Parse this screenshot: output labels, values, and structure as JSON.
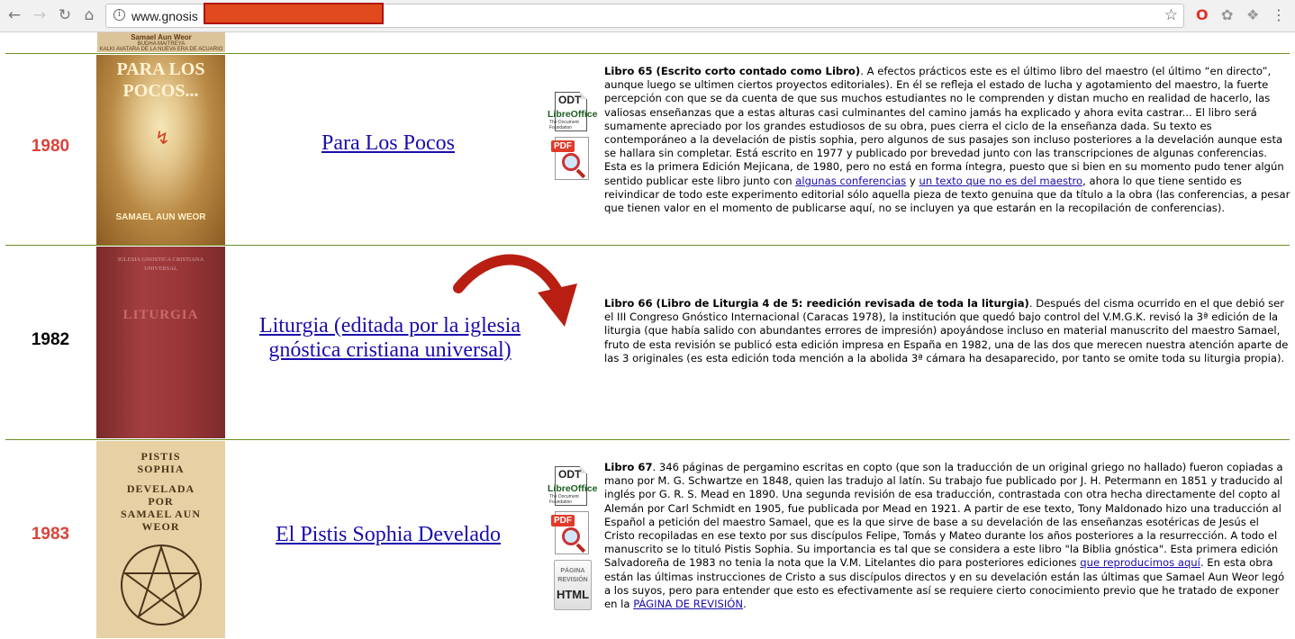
{
  "browser": {
    "url": "www.gnosis",
    "icons": {
      "back": "back-arrow-icon",
      "forward": "forward-arrow-icon",
      "reload": "reload-icon",
      "home": "home-icon",
      "info": "info-icon",
      "bookmark": "star-icon"
    }
  },
  "top_cover_text": [
    "Samael Aun Weor",
    "BUDHA MAITREYA",
    "KALKI AVATARA DE LA NUEVA ERA DE ACUARIO"
  ],
  "rows": [
    {
      "year": "1980",
      "year_color": "#d9443a",
      "title": "Para Los Pocos",
      "cover": {
        "line1": "PARA LOS",
        "line2": "POCOS...",
        "author": "SAMAEL AUN WEOR"
      },
      "desc_bold": "Libro 65 (Escrito corto contado como Libro)",
      "desc_p1": ". A efectos prácticos este es el último libro del maestro (el último “en directo”, aunque luego se ultimen ciertos proyectos editoriales). En él se refleja el estado de lucha y agotamiento del maestro, la fuerte percepción con que se da cuenta de que sus muchos estudiantes no le comprenden y distan mucho en realidad de hacerlo, las valiosas enseñanzas que a estas alturas casi culminantes del camino jamás ha explicado y ahora evita castrar... El libro será sumamente apreciado por los grandes estudiosos de su obra, pues cierra el ciclo de la enseñanza dada. Su texto es contemporáneo a la develación de pistis sophia, pero algunos de sus pasajes son incluso posteriores a la develación aunque esta se hallara sin completar. Está escrito en 1977 y publicado por brevedad junto con las transcripciones de algunas conferencias. Esta es la primera Edición Mejicana, de 1980, pero no está en forma íntegra, puesto que si bien en su momento pudo tener algún sentido publicar este libro junto con ",
      "link1": "algunas conferencias",
      "desc_p2": " y ",
      "link2": "un texto que no es del maestro",
      "desc_p3": ", ahora lo que tiene sentido es reivindicar de todo este experimento editorial sólo aquella pieza de texto genuina que da título a la obra (las conferencias, a pesar que tienen valor en el momento de publicarse aquí, no se incluyen ya que estarán en la recopilación de conferencias).",
      "icons": [
        "odt",
        "pdf"
      ]
    },
    {
      "year": "1982",
      "year_color": "#000000",
      "title": "Liturgia (editada por la iglesia gnóstica cristiana universal)",
      "cover": {
        "line1": "IGLESIA GNOSTICA CRISTIANA",
        "line2": "UNIVERSAL",
        "spine": "LITURGIA"
      },
      "desc_bold": "Libro 66 (Libro de Liturgia 4 de 5: reedición revisada de toda la liturgia)",
      "desc_p1": ". Después del cisma ocurrido en el que debió ser el III Congreso Gnóstico Internacional (Caracas 1978), la institución que quedó bajo control del V.M.G.K. revisó la 3ª edición de la liturgia (que había salido con abundantes errores de impresión) apoyándose incluso en material manuscrito del maestro Samael, fruto de esta revisión se publicó esta edición impresa en España en 1982, una de las dos que merecen nuestra atención aparte de las 3 originales (es esta edición toda mención a la abolida 3ª cámara ha desaparecido, por tanto se omite toda su liturgia propia).",
      "arrow_color": "#b81f12"
    },
    {
      "year": "1983",
      "year_color": "#d9443a",
      "title": "El Pistis Sophia Develado",
      "cover": {
        "l1": "PISTIS",
        "l2": "SOPHIA",
        "l3": "DEVELADA",
        "l4": "POR",
        "l5": "SAMAEL AUN",
        "l6": "WEOR"
      },
      "desc_bold": "Libro 67",
      "desc_p1": ". 346 páginas de pergamino escritas en copto (que son la traducción de un original griego no hallado) fueron copiadas a mano por M. G. Schwartze en 1848, quien las tradujo al latín. Su trabajo fue publicado por J. H. Petermann en 1851 y traducido al inglés por G. R. S. Mead en 1890. Una segunda revisión de esa traducción, contrastada con otra hecha directamente del copto al Alemán por Carl Schmidt en 1905, fue publicada por Mead en 1921. A partir de ese texto, Tony Maldonado hizo una traducción al Español a petición del maestro Samael, que es la que sirve de base a su develación de las enseñanzas esotéricas de Jesús el Cristo recopiladas en ese texto por sus discípulos Felipe, Tomás y Mateo durante los años posteriores a la resurrección. A todo el manuscrito se lo tituló Pistis Sophia. Su importancia es tal que se considera a este libro \"la Biblia gnóstica\". Esta primera edición Salvadoreña de 1983 no tenia la nota que la V.M. Litelantes dio para posteriores ediciones ",
      "link1": "que reproducimos aquí",
      "desc_p2": ". En esta obra están las últimas instrucciones de Cristo a sus discípulos directos y en su develación están las últimas que Samael Aun Weor legó a los suyos, pero para entender que esto es efectivamente así se requiere cierto conocimiento previo que he tratado de exponer en la ",
      "link2": "PÁGINA DE REVISIÓN",
      "desc_p3": ".",
      "icons": [
        "odt",
        "pdf",
        "html"
      ]
    }
  ],
  "icon_labels": {
    "odt": "ODT",
    "libre": "Libre",
    "office": "Office",
    "foundation": "The Document Foundation",
    "pdf": "PDF",
    "html_top": "PÁGINA REVISIÓN",
    "html_bottom": "HTML"
  }
}
